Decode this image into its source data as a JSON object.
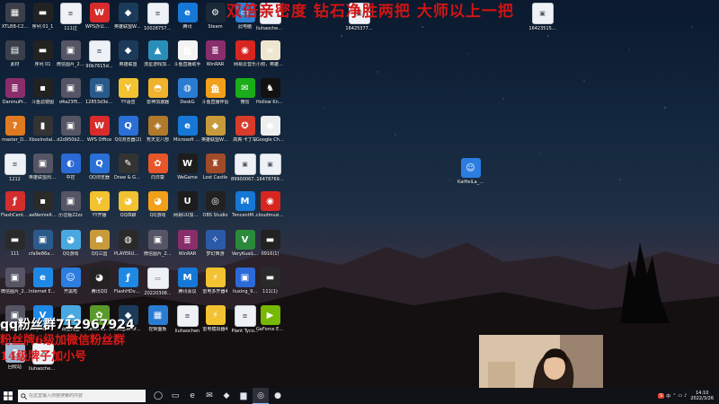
{
  "stream_overlay": {
    "top_text": "双倍亲密度 钻石净胜两把 大师以上一把",
    "line1": "qq粉丝群712967924",
    "line2": "粉丝牌6级加微信粉丝群",
    "line3": "14级牌子加小号"
  },
  "colors": {
    "overlay_red": "#d01414",
    "taskbar_bg": "#101217"
  },
  "desktop_icons": [
    {
      "label": "XTLBB-C2...",
      "icon": "game-icon",
      "color": "#3a3f4a",
      "glyph": "▦"
    },
    {
      "label": "序列 01_1",
      "icon": "video-icon",
      "color": "#222",
      "glyph": "▬"
    },
    {
      "label": "111过",
      "icon": "file-icon",
      "color": "#eef2f6",
      "glyph": "≡",
      "file": true
    },
    {
      "label": "WPS办公助手",
      "icon": "wps-icon",
      "color": "#d92b2b",
      "glyph": "W"
    },
    {
      "label": "英雄联盟WeGame版",
      "icon": "lol-icon",
      "color": "#1c3b5a",
      "glyph": "◆"
    },
    {
      "label": "10028757r...",
      "icon": "file-icon",
      "color": "#eef2f6",
      "glyph": "≡",
      "file": true
    },
    {
      "label": "腾讯",
      "icon": "edge-icon",
      "color": "#1677d6",
      "glyph": "e"
    },
    {
      "label": "Steam",
      "icon": "steam-icon",
      "color": "#1b2838",
      "glyph": "⚙"
    },
    {
      "label": "此电脑",
      "icon": "computer-icon",
      "color": "#2f7fd3",
      "glyph": "▭"
    },
    {
      "label": "liuhaochen - 快捷方式 (2)",
      "icon": "shortcut-icon",
      "color": "#eef2f6",
      "glyph": "⇗",
      "file": true
    },
    {
      "label": "16425377...",
      "icon": "image-icon",
      "color": "#eef2f6",
      "glyph": "▣",
      "file": true
    },
    {
      "label": "16423515...",
      "icon": "image-icon",
      "color": "#eef2f6",
      "glyph": "▣",
      "file": true
    },
    {
      "label": "素材",
      "icon": "folder-icon",
      "color": "#3a3f4a",
      "glyph": "▤"
    },
    {
      "label": "序列 01",
      "icon": "video-icon",
      "color": "#222",
      "glyph": "▬"
    },
    {
      "label": "微信图片_2021102...",
      "icon": "image-icon",
      "color": "#556",
      "glyph": "▣"
    },
    {
      "label": "90b7615d...",
      "icon": "file-icon",
      "color": "#eef2f6",
      "glyph": "≡",
      "file": true
    },
    {
      "label": "英雄联盟",
      "icon": "lol-icon",
      "color": "#1c3b5a",
      "glyph": "◆"
    },
    {
      "label": "流星游戏加速器",
      "icon": "accelerator-icon",
      "color": "#2a8fb8",
      "glyph": "▲"
    },
    {
      "label": "斗鱼直播助手",
      "icon": "douyu-icon",
      "color": "#f3f3f3",
      "glyph": "鱼"
    },
    {
      "label": "WinRAR",
      "icon": "winrar-icon",
      "color": "#8a2d6b",
      "glyph": "≣"
    },
    {
      "label": "网易云音乐",
      "icon": "netease-icon",
      "color": "#d7261f",
      "glyph": "◉"
    },
    {
      "label": "小狗，英雄杀手(Skul Th...",
      "icon": "skul-icon",
      "color": "#efe6d0",
      "glyph": "☠"
    },
    {
      "label": "DanmuPr...",
      "icon": "winrar-icon",
      "color": "#8a2d6b",
      "glyph": "≣"
    },
    {
      "label": "斗鱼滤镜图",
      "icon": "image-icon",
      "color": "#222",
      "glyph": "▪"
    },
    {
      "label": "d4a23f5...",
      "icon": "image-icon",
      "color": "#556",
      "glyph": "▣"
    },
    {
      "label": "12853d3e8...",
      "icon": "image-icon",
      "color": "#2a5a8a",
      "glyph": "▣"
    },
    {
      "label": "YY语音",
      "icon": "yy-icon",
      "color": "#f2c230",
      "glyph": "Y"
    },
    {
      "label": "雷神加速器",
      "icon": "leishen-icon",
      "color": "#f0b32b",
      "glyph": "◓"
    },
    {
      "label": "DeskG",
      "icon": "globe-icon",
      "color": "#2a7bd2",
      "glyph": "◍"
    },
    {
      "label": "斗鱼直播伴侣",
      "icon": "douyu-icon",
      "color": "#f2a019",
      "glyph": "鱼"
    },
    {
      "label": "微信",
      "icon": "wechat-icon",
      "color": "#1aad19",
      "glyph": "✉"
    },
    {
      "label": "Hollow Knight",
      "icon": "hollow-knight-icon",
      "color": "#111",
      "glyph": "♞"
    },
    {
      "label": "master_D...",
      "icon": "game-icon",
      "color": "#e07a20",
      "glyph": "?"
    },
    {
      "label": "XboxInstal...",
      "icon": "xbox-icon",
      "color": "#333",
      "glyph": "▮"
    },
    {
      "label": "d2d950b2...",
      "icon": "image-icon",
      "color": "#556",
      "glyph": "▣"
    },
    {
      "label": "WPS Office",
      "icon": "wps-icon",
      "color": "#d92b2b",
      "glyph": "W"
    },
    {
      "label": "QQ浏览器(2)",
      "icon": "qq-browser-icon",
      "color": "#2a6fd6",
      "glyph": "Q"
    },
    {
      "label": "秀天龙八部",
      "icon": "game-icon",
      "color": "#b07a2a",
      "glyph": "◈"
    },
    {
      "label": "Microsoft Edge",
      "icon": "edge-icon",
      "color": "#1677d6",
      "glyph": "e"
    },
    {
      "label": "英雄联盟WeGame版",
      "icon": "lol-icon",
      "color": "#c79a3a",
      "glyph": "◆"
    },
    {
      "label": "高爽·卡丁车",
      "icon": "game-icon",
      "color": "#d83b2a",
      "glyph": "✪"
    },
    {
      "label": "Google Chrome",
      "icon": "chrome-icon",
      "color": "#eee",
      "glyph": "◉"
    },
    {
      "label": "KaiHeiLa_...",
      "icon": "kaiheila-icon",
      "color": "#2b7de1",
      "glyph": "☺"
    },
    {
      "label": "1212",
      "icon": "file-icon",
      "color": "#eef2f6",
      "glyph": "≡",
      "file": true
    },
    {
      "label": "英雄联盟周边个性定制...",
      "icon": "image-icon",
      "color": "#556",
      "glyph": "▣"
    },
    {
      "label": "中控",
      "icon": "app-icon",
      "color": "#2b6ad6",
      "glyph": "◐"
    },
    {
      "label": "QQ浏览器",
      "icon": "qq-browser-icon",
      "color": "#2a6fd6",
      "glyph": "Q"
    },
    {
      "label": "Draw & Guess",
      "icon": "draw-guess-icon",
      "color": "#333",
      "glyph": "✎"
    },
    {
      "label": "向日葵",
      "icon": "sunflower-icon",
      "color": "#e8562a",
      "glyph": "✿"
    },
    {
      "label": "WeGame",
      "icon": "wegame-icon",
      "color": "#1d1d1d",
      "glyph": "W"
    },
    {
      "label": "Lost Castle",
      "icon": "lost-castle-icon",
      "color": "#a04a2a",
      "glyph": "♜"
    },
    {
      "label": "89900067_...",
      "icon": "image-icon",
      "color": "#eef2f6",
      "glyph": "▣",
      "file": true
    },
    {
      "label": "16478769...",
      "icon": "image-icon",
      "color": "#eef2f6",
      "glyph": "▣",
      "file": true
    },
    {
      "label": "FlashCente...",
      "icon": "flash-icon",
      "color": "#d22e2e",
      "glyph": "ƒ"
    },
    {
      "label": "aeNemielt...",
      "icon": "image-icon",
      "color": "#2a2a2a",
      "glyph": "▪"
    },
    {
      "label": "历往版22zz",
      "icon": "image-icon",
      "color": "#556",
      "glyph": "▣"
    },
    {
      "label": "YY开播",
      "icon": "yy-icon",
      "color": "#f2c230",
      "glyph": "Y"
    },
    {
      "label": "QQ四聊",
      "icon": "qq-icon",
      "color": "#f2c230",
      "glyph": "◕"
    },
    {
      "label": "QQ游戏",
      "icon": "qq-game-icon",
      "color": "#f2a019",
      "glyph": "◕"
    },
    {
      "label": "网易UU加速器",
      "icon": "uu-icon",
      "color": "#1d1d1d",
      "glyph": "U"
    },
    {
      "label": "OBS Studio",
      "icon": "obs-icon",
      "color": "#222",
      "glyph": "◎"
    },
    {
      "label": "TencentM...",
      "icon": "tencent-meeting-icon",
      "color": "#1677d6",
      "glyph": "M"
    },
    {
      "label": "cloudmusic...",
      "icon": "netease-icon",
      "color": "#d7261f",
      "glyph": "◉"
    },
    {
      "label": "111",
      "icon": "file-icon",
      "color": "#2a2a2a",
      "glyph": "▬"
    },
    {
      "label": "cfa9e86ae...",
      "icon": "image-icon",
      "color": "#2a5a8a",
      "glyph": "▣"
    },
    {
      "label": "QQ游戏",
      "icon": "qq-game-icon",
      "color": "#4aa8e0",
      "glyph": "◕"
    },
    {
      "label": "QQ三国",
      "icon": "game-icon",
      "color": "#c79a3a",
      "glyph": "☗"
    },
    {
      "label": "PLAYERUNKNOWN BATTLEGR...",
      "icon": "pubg-icon",
      "color": "#2a2a2a",
      "glyph": "◍"
    },
    {
      "label": "微信图片_2022011...",
      "icon": "image-icon",
      "color": "#556",
      "glyph": "▣"
    },
    {
      "label": "WinRAR",
      "icon": "winrar-icon",
      "color": "#8a2d6b",
      "glyph": "≣"
    },
    {
      "label": "梦幻西游",
      "icon": "game-icon",
      "color": "#2a5aa8",
      "glyph": "✧"
    },
    {
      "label": "VeryKuaiL...",
      "icon": "app-icon",
      "color": "#2b8a3a",
      "glyph": "V"
    },
    {
      "label": "0916(1)",
      "icon": "video-icon",
      "color": "#222",
      "glyph": "▬"
    },
    {
      "label": "微信图片_2021111...",
      "icon": "image-icon",
      "color": "#556",
      "glyph": "▣"
    },
    {
      "label": "Internet Explorer",
      "icon": "ie-icon",
      "color": "#1e88e5",
      "glyph": "e"
    },
    {
      "label": "开黑啦",
      "icon": "kaiheila-icon",
      "color": "#2b7de1",
      "glyph": "☺"
    },
    {
      "label": "腾讯QQ",
      "icon": "qq-icon",
      "color": "#222",
      "glyph": "◕"
    },
    {
      "label": "FlashHDv2...",
      "icon": "flash-icon",
      "color": "#1e88e5",
      "glyph": "ƒ"
    },
    {
      "label": "20220308...",
      "icon": "file-icon",
      "color": "#cfcfcf",
      "glyph": "▭",
      "file": true
    },
    {
      "label": "腾讯会议",
      "icon": "tencent-meeting-icon",
      "color": "#1677d6",
      "glyph": "M"
    },
    {
      "label": "雷电多开器4",
      "icon": "ldplayer-icon",
      "color": "#f2c230",
      "glyph": "⚡"
    },
    {
      "label": "liuxing_9...",
      "icon": "image-icon",
      "color": "#2b6ad6",
      "glyph": "▣"
    },
    {
      "label": "111(1)",
      "icon": "file-icon",
      "color": "#2a2a2a",
      "glyph": "▬"
    },
    {
      "label": "6c2780ea5...",
      "icon": "image-icon",
      "color": "#556",
      "glyph": "▣"
    },
    {
      "label": "VeryKuai VK加速器",
      "icon": "verykuai-icon",
      "color": "#1e88e5",
      "glyph": "V"
    },
    {
      "label": "百度网盘",
      "icon": "baidu-icon",
      "color": "#4aa8e0",
      "glyph": "☁"
    },
    {
      "label": "Plants vs. Zombies G...",
      "icon": "pvz-icon",
      "color": "#5a9a2a",
      "glyph": "✿"
    },
    {
      "label": "League of Legends",
      "icon": "lol-icon",
      "color": "#1c3b5a",
      "glyph": "◆"
    },
    {
      "label": "控制面板",
      "icon": "control-panel-icon",
      "color": "#2a7bd2",
      "glyph": "▦"
    },
    {
      "label": "liuhaochen",
      "icon": "shortcut-icon",
      "color": "#eef2f6",
      "glyph": "≡",
      "file": true
    },
    {
      "label": "雷电模拟器4",
      "icon": "ldplayer-icon",
      "color": "#f2c230",
      "glyph": "⚡"
    },
    {
      "label": "Plant Tyco...",
      "icon": "file-icon",
      "color": "#eef2f6",
      "glyph": "≡",
      "file": true
    },
    {
      "label": "GeForce Experience",
      "icon": "geforce-icon",
      "color": "#76b900",
      "glyph": "▶"
    },
    {
      "label": "回收站",
      "icon": "recycle-bin-icon",
      "color": "#9db7d3",
      "glyph": "♻"
    },
    {
      "label": "liuhaochen - 快捷方式",
      "icon": "shortcut-icon",
      "color": "#eef2f6",
      "glyph": "⇗",
      "file": true
    }
  ],
  "taskbar": {
    "search_placeholder": "在这里输入你要搜索的内容",
    "apps": [
      {
        "icon": "task-view-icon",
        "glyph": "◯"
      },
      {
        "icon": "multitask-icon",
        "glyph": "▭"
      },
      {
        "icon": "edge-icon",
        "glyph": "e"
      },
      {
        "icon": "wechat-icon",
        "glyph": "✉"
      },
      {
        "icon": "game-icon",
        "glyph": "◆"
      },
      {
        "icon": "file-explorer-icon",
        "glyph": "▆"
      },
      {
        "icon": "obs-icon",
        "glyph": "◎",
        "active": true
      },
      {
        "icon": "yy-icon",
        "glyph": "●"
      }
    ],
    "ime_indicator": "中",
    "clock_time": "14:10",
    "clock_date": "2022/3/26"
  }
}
